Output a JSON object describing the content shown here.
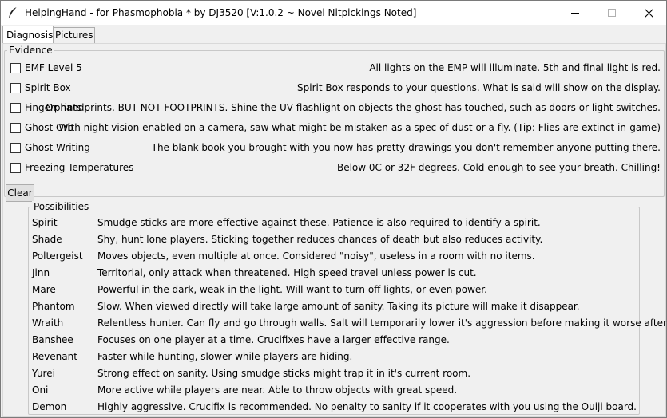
{
  "window": {
    "title": "HelpingHand - for Phasmophobia * by DJ3520 [V:1.0.2 ~ Novel Nitpickings Noted]",
    "icon": "feather-icon",
    "controls": [
      "minimize-icon",
      "maximize-icon",
      "close-icon"
    ]
  },
  "tabs": [
    {
      "label": "Diagnosis",
      "active": true
    },
    {
      "label": "Pictures",
      "active": false
    }
  ],
  "evidence": {
    "group_label": "Evidence",
    "items": [
      {
        "label": "EMF Level 5",
        "checked": false,
        "description": "All lights on the EMP will illuminate. 5th and final light is red."
      },
      {
        "label": "Spirit Box",
        "checked": false,
        "description": "Spirit Box responds to your questions. What is said will show on the display."
      },
      {
        "label": "Fingerprints",
        "checked": false,
        "description": "Or handprints. BUT NOT FOOTPRINTS. Shine the UV flashlight on objects the ghost has touched, such as doors or light switches."
      },
      {
        "label": "Ghost Orb",
        "checked": false,
        "description": "With night vision enabled on a camera, saw what might be mistaken as a spec of dust or a fly. (Tip: Flies are extinct in-game)"
      },
      {
        "label": "Ghost Writing",
        "checked": false,
        "description": "The blank book you brought with you now has pretty drawings you don't remember anyone putting there."
      },
      {
        "label": "Freezing Temperatures",
        "checked": false,
        "description": "Below 0C or 32F degrees. Cold enough to see your breath. Chilling!"
      }
    ],
    "clear_label": "Clear"
  },
  "possibilities": {
    "group_label": "Possibilities",
    "items": [
      {
        "name": "Spirit",
        "description": "Smudge sticks are more effective against these. Patience is also required to identify a spirit."
      },
      {
        "name": "Shade",
        "description": "Shy, hunt lone players. Sticking together reduces chances of death but also reduces activity."
      },
      {
        "name": "Poltergeist",
        "description": "Moves objects, even multiple at once. Considered \"noisy\", useless in a room with no items."
      },
      {
        "name": "Jinn",
        "description": "Territorial, only attack when threatened. High speed travel unless power is cut."
      },
      {
        "name": "Mare",
        "description": "Powerful in the dark, weak in the light. Will want to turn off lights, or even power."
      },
      {
        "name": "Phantom",
        "description": "Slow. When viewed directly will take large amount of sanity. Taking its picture will make it disappear."
      },
      {
        "name": "Wraith",
        "description": "Relentless hunter. Can fly and go through walls. Salt will temporarily lower it's aggression before making it worse afterwords."
      },
      {
        "name": "Banshee",
        "description": "Focuses on one player at a time. Crucifixes have a larger effective range."
      },
      {
        "name": "Revenant",
        "description": "Faster while hunting, slower while players are hiding."
      },
      {
        "name": "Yurei",
        "description": "Strong effect on sanity. Using smudge sticks might trap it in it's current room."
      },
      {
        "name": "Oni",
        "description": "More active while players are near. Able to throw objects with great speed."
      },
      {
        "name": "Demon",
        "description": "Highly aggressive. Crucifix is recommended. No penalty to sanity if it cooperates with you using the Ouiji board."
      }
    ]
  }
}
